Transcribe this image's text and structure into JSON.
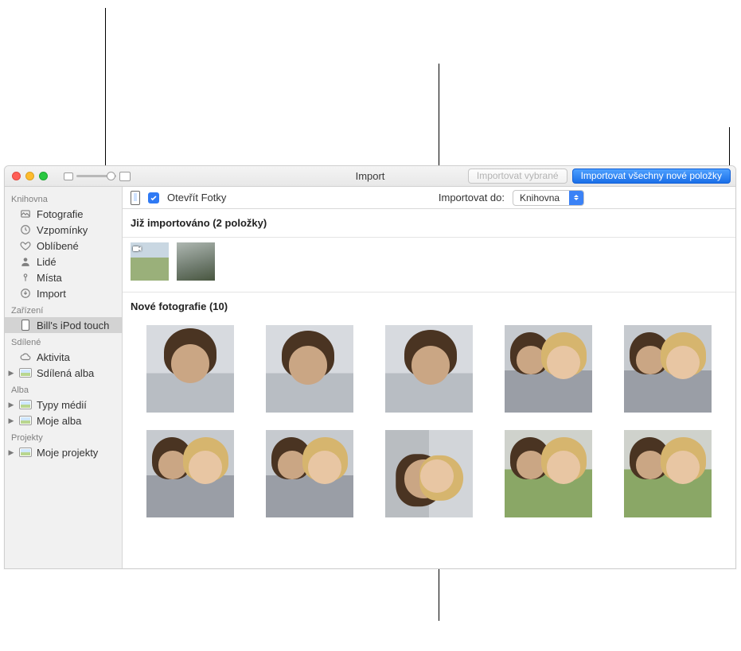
{
  "window": {
    "title": "Import",
    "buttons": {
      "import_selected": "Importovat vybrané",
      "import_all_new": "Importovat všechny nové položky"
    }
  },
  "subbar": {
    "open_photos_label": "Otevřít Fotky",
    "open_photos_checked": true,
    "import_to_label": "Importovat do:",
    "import_to_value": "Knihovna"
  },
  "sidebar": {
    "sections": {
      "library": "Knihovna",
      "devices": "Zařízení",
      "shared": "Sdílené",
      "albums": "Alba",
      "projects": "Projekty"
    },
    "library_items": [
      "Fotografie",
      "Vzpomínky",
      "Oblíbené",
      "Lidé",
      "Místa",
      "Import"
    ],
    "device_item": "Bill's iPod touch",
    "shared_items": [
      "Aktivita",
      "Sdílená alba"
    ],
    "album_items": [
      "Typy médií",
      "Moje alba"
    ],
    "project_items": [
      "Moje projekty"
    ]
  },
  "sections": {
    "already_imported": "Již importováno (2 položky)",
    "new_photos": "Nové fotografie (10)"
  },
  "already_imported_items": [
    {
      "is_video": true
    },
    {
      "is_video": false
    }
  ],
  "new_photo_count": 10
}
